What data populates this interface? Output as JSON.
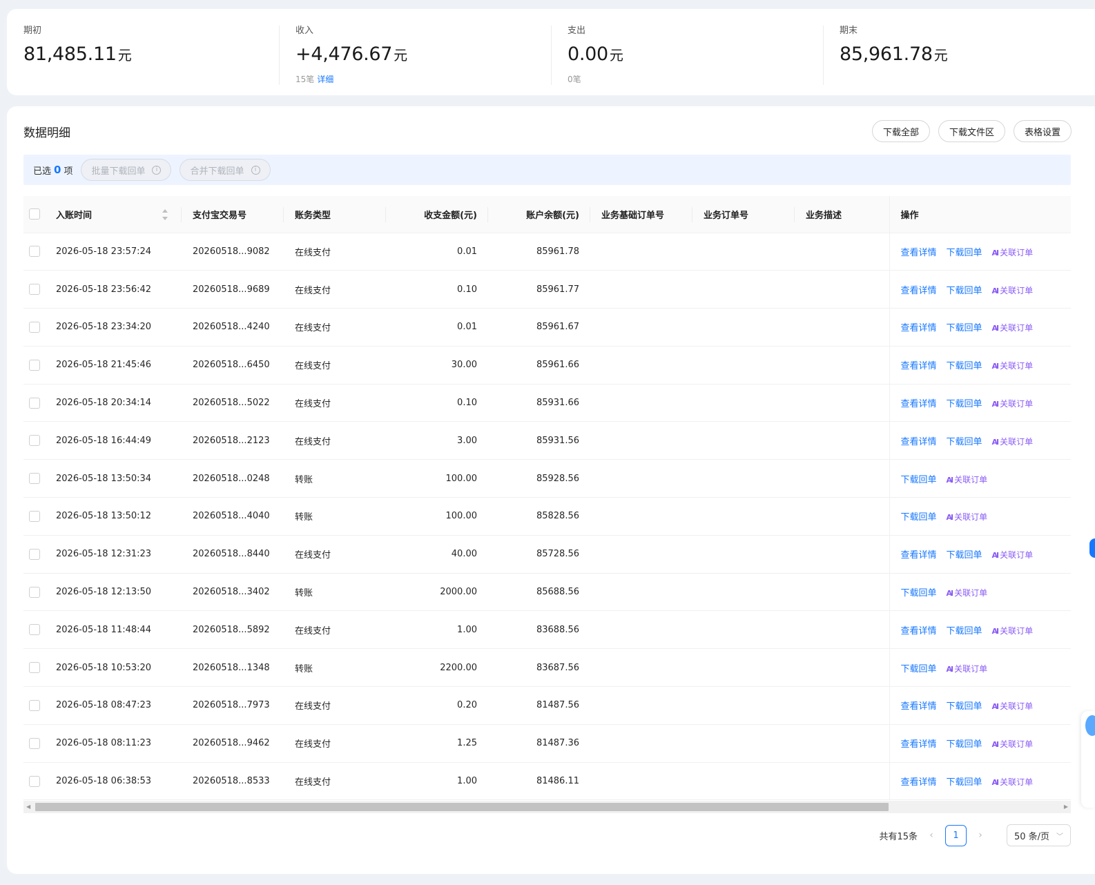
{
  "summary": {
    "opening": {
      "label": "期初",
      "value": "81,485.11",
      "unit": "元"
    },
    "income": {
      "label": "收入",
      "value": "+4,476.67",
      "unit": "元",
      "count": "15笔",
      "detail_link": "详细"
    },
    "expense": {
      "label": "支出",
      "value": "0.00",
      "unit": "元",
      "count": "0笔"
    },
    "closing": {
      "label": "期末",
      "value": "85,961.78",
      "unit": "元"
    }
  },
  "section": {
    "title": "数据明细",
    "actions": [
      "下载全部",
      "下载文件区",
      "表格设置"
    ]
  },
  "selection": {
    "prefix": "已选",
    "count": "0",
    "suffix": "项",
    "batch_download": "批量下载回单",
    "merge_download": "合并下载回单"
  },
  "table": {
    "columns": [
      "入账时间",
      "支付宝交易号",
      "账务类型",
      "收支金额(元)",
      "账户余额(元)",
      "业务基础订单号",
      "业务订单号",
      "业务描述",
      "操作"
    ],
    "ops": {
      "view": "查看详情",
      "download": "下载回单",
      "ai_mark": "AI",
      "link": "关联订单"
    },
    "rows": [
      {
        "time": "2026-05-18 23:57:24",
        "trade_no": "20260518...9082",
        "type": "在线支付",
        "amount": "0.01",
        "balance": "85961.78",
        "has_view": true
      },
      {
        "time": "2026-05-18 23:56:42",
        "trade_no": "20260518...9689",
        "type": "在线支付",
        "amount": "0.10",
        "balance": "85961.77",
        "has_view": true
      },
      {
        "time": "2026-05-18 23:34:20",
        "trade_no": "20260518...4240",
        "type": "在线支付",
        "amount": "0.01",
        "balance": "85961.67",
        "has_view": true
      },
      {
        "time": "2026-05-18 21:45:46",
        "trade_no": "20260518...6450",
        "type": "在线支付",
        "amount": "30.00",
        "balance": "85961.66",
        "has_view": true
      },
      {
        "time": "2026-05-18 20:34:14",
        "trade_no": "20260518...5022",
        "type": "在线支付",
        "amount": "0.10",
        "balance": "85931.66",
        "has_view": true
      },
      {
        "time": "2026-05-18 16:44:49",
        "trade_no": "20260518...2123",
        "type": "在线支付",
        "amount": "3.00",
        "balance": "85931.56",
        "has_view": true
      },
      {
        "time": "2026-05-18 13:50:34",
        "trade_no": "20260518...0248",
        "type": "转账",
        "amount": "100.00",
        "balance": "85928.56",
        "has_view": false
      },
      {
        "time": "2026-05-18 13:50:12",
        "trade_no": "20260518...4040",
        "type": "转账",
        "amount": "100.00",
        "balance": "85828.56",
        "has_view": false
      },
      {
        "time": "2026-05-18 12:31:23",
        "trade_no": "20260518...8440",
        "type": "在线支付",
        "amount": "40.00",
        "balance": "85728.56",
        "has_view": true
      },
      {
        "time": "2026-05-18 12:13:50",
        "trade_no": "20260518...3402",
        "type": "转账",
        "amount": "2000.00",
        "balance": "85688.56",
        "has_view": false
      },
      {
        "time": "2026-05-18 11:48:44",
        "trade_no": "20260518...5892",
        "type": "在线支付",
        "amount": "1.00",
        "balance": "83688.56",
        "has_view": true
      },
      {
        "time": "2026-05-18 10:53:20",
        "trade_no": "20260518...1348",
        "type": "转账",
        "amount": "2200.00",
        "balance": "83687.56",
        "has_view": false
      },
      {
        "time": "2026-05-18 08:47:23",
        "trade_no": "20260518...7973",
        "type": "在线支付",
        "amount": "0.20",
        "balance": "81487.56",
        "has_view": true
      },
      {
        "time": "2026-05-18 08:11:23",
        "trade_no": "20260518...9462",
        "type": "在线支付",
        "amount": "1.25",
        "balance": "81487.36",
        "has_view": true
      },
      {
        "time": "2026-05-18 06:38:53",
        "trade_no": "20260518...8533",
        "type": "在线支付",
        "amount": "1.00",
        "balance": "81486.11",
        "has_view": true
      }
    ]
  },
  "pagination": {
    "total": "共有15条",
    "current_page": "1",
    "page_size": "50 条/页"
  },
  "icons": {
    "prev": "chevron-left-icon",
    "next": "chevron-right-icon",
    "info": "info-icon",
    "sort": "sort-icon"
  },
  "colors": {
    "accent": "#1677ff",
    "ai": "#8a5cf6"
  }
}
